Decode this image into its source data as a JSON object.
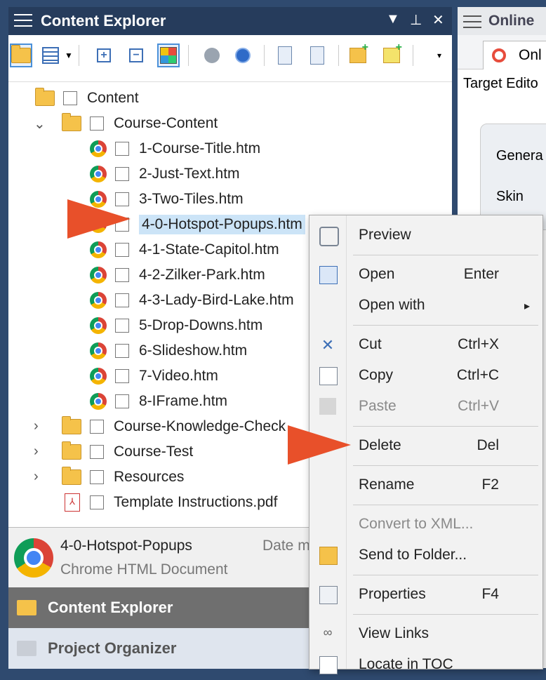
{
  "panel": {
    "title": "Content Explorer"
  },
  "right": {
    "title": "Online",
    "tab": "Onl",
    "label": "Target Edito",
    "items": [
      "Genera",
      "Skin"
    ]
  },
  "tree": {
    "items": [
      {
        "label": "Content",
        "type": "folder-open"
      },
      {
        "label": "Course-Content",
        "type": "folder-open"
      },
      {
        "label": "1-Course-Title.htm",
        "type": "htm"
      },
      {
        "label": "2-Just-Text.htm",
        "type": "htm"
      },
      {
        "label": "3-Two-Tiles.htm",
        "type": "htm"
      },
      {
        "label": "4-0-Hotspot-Popups.htm",
        "type": "htm"
      },
      {
        "label": "4-1-State-Capitol.htm",
        "type": "htm"
      },
      {
        "label": "4-2-Zilker-Park.htm",
        "type": "htm"
      },
      {
        "label": "4-3-Lady-Bird-Lake.htm",
        "type": "htm"
      },
      {
        "label": "5-Drop-Downs.htm",
        "type": "htm"
      },
      {
        "label": "6-Slideshow.htm",
        "type": "htm"
      },
      {
        "label": "7-Video.htm",
        "type": "htm"
      },
      {
        "label": "8-IFrame.htm",
        "type": "htm"
      },
      {
        "label": "Course-Knowledge-Check",
        "type": "folder"
      },
      {
        "label": "Course-Test",
        "type": "folder"
      },
      {
        "label": "Resources",
        "type": "folder"
      },
      {
        "label": "Template Instructions.pdf",
        "type": "pdf"
      }
    ]
  },
  "status": {
    "name": "4-0-Hotspot-Popups",
    "type": "Chrome HTML Document",
    "date_label": "Date m"
  },
  "nav": {
    "content_explorer": "Content Explorer",
    "project_organizer": "Project Organizer"
  },
  "menu": {
    "items": [
      {
        "label": "Preview",
        "shortcut": ""
      },
      {
        "label": "Open",
        "shortcut": "Enter"
      },
      {
        "label": "Open with",
        "shortcut": "▸"
      },
      {
        "label": "Cut",
        "shortcut": "Ctrl+X"
      },
      {
        "label": "Copy",
        "shortcut": "Ctrl+C"
      },
      {
        "label": "Paste",
        "shortcut": "Ctrl+V"
      },
      {
        "label": "Delete",
        "shortcut": "Del"
      },
      {
        "label": "Rename",
        "shortcut": "F2"
      },
      {
        "label": "Convert to XML...",
        "shortcut": ""
      },
      {
        "label": "Send to Folder...",
        "shortcut": ""
      },
      {
        "label": "Properties",
        "shortcut": "F4"
      },
      {
        "label": "View Links",
        "shortcut": ""
      },
      {
        "label": "Locate in TOC",
        "shortcut": ""
      }
    ]
  },
  "colors": {
    "title_bg": "#263c5c",
    "selection": "#cce4f7",
    "arrow": "#e8502a",
    "nav_active": "#6f6f6f"
  }
}
